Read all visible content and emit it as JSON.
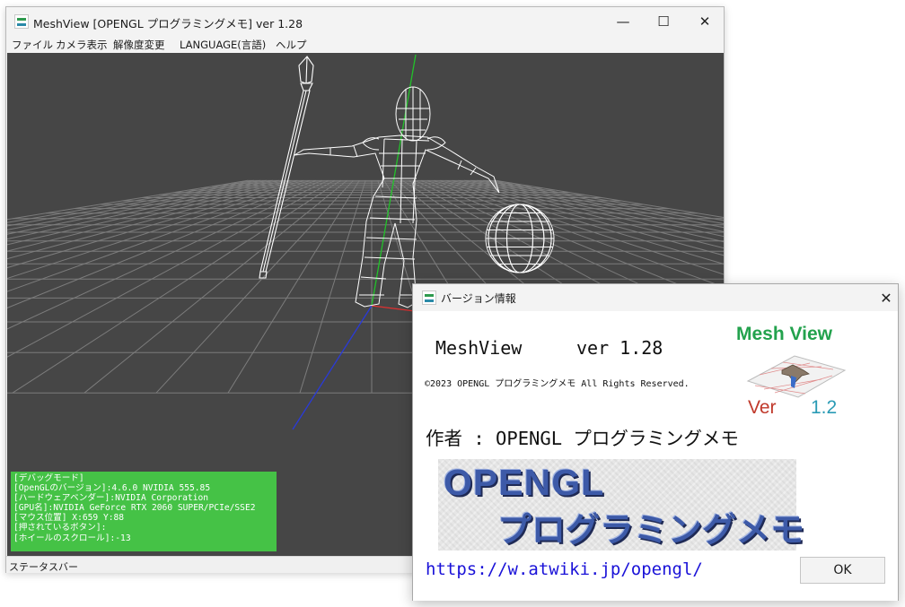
{
  "colors": {
    "viewport_bg": "#464646",
    "debug_bg": "#45c246",
    "axis_x": "#e03030",
    "axis_y": "#22c22a",
    "axis_z": "#2a3ad8",
    "link": "#1a12d8"
  },
  "main_window": {
    "title": "MeshView [OPENGL プログラミングメモ] ver 1.28",
    "icon": "meshview-app-icon",
    "controls": {
      "minimize": "—",
      "maximize": "☐",
      "close": "✕"
    },
    "menu": [
      "ファイル",
      "カメラ表示",
      "解像度変更",
      "LANGUAGE(言語)",
      "ヘルプ"
    ],
    "debug_lines": [
      "[デバッグモード]",
      "[OpenGLのバージョン]:4.6.0 NVIDIA 555.85",
      "[ハードウェアベンダー]:NVIDIA Corporation",
      "[GPU名]:NVIDIA GeForce RTX 2060 SUPER/PCIe/SSE2",
      "[マウス位置] X:659 Y:88",
      "[押されているボタン]:",
      "[ホイールのスクロール]:-13"
    ],
    "status": "ステータスバー"
  },
  "about_dialog": {
    "title": "バージョン情報",
    "close": "✕",
    "app_name": "MeshView",
    "version": "ver 1.28",
    "copyright": "©2023 OPENGL プログラミングメモ All Rights Reserved.",
    "author": "作者 : OPENGL プログラミングメモ",
    "url": "https://w.atwiki.jp/opengl/",
    "ok_label": "OK",
    "logo": {
      "title": "Mesh View",
      "ver_word": "Ver",
      "ver_num": "1.2"
    },
    "banner": {
      "line1": "OPENGL",
      "line2": "プログラミングメモ"
    }
  }
}
